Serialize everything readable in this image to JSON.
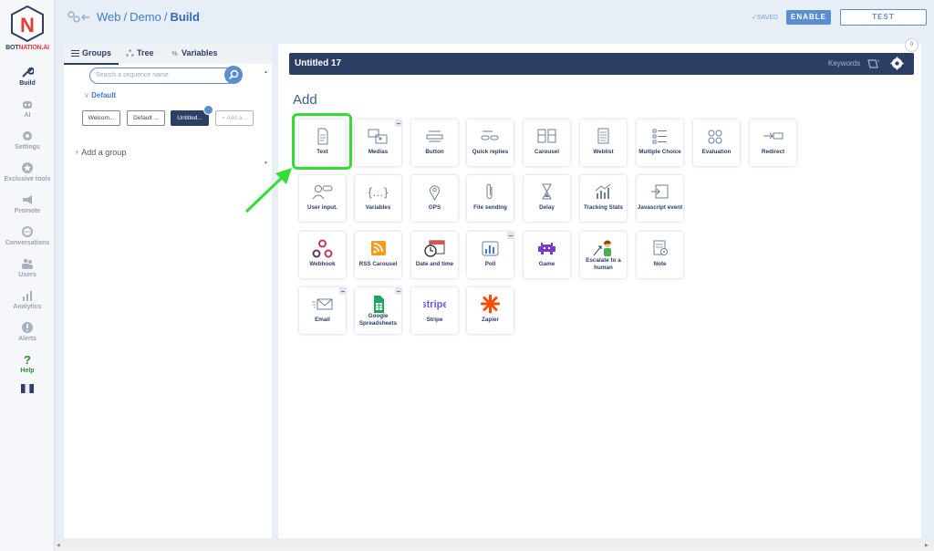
{
  "nav": {
    "logo_text_a": "BOT",
    "logo_text_b": "NATION.AI",
    "items": [
      {
        "label": "Build",
        "icon": "wrench-icon"
      },
      {
        "label": "AI",
        "icon": "robot-icon"
      },
      {
        "label": "Settings",
        "icon": "gear-icon"
      },
      {
        "label": "Exclusive tools",
        "icon": "star-badge-icon"
      },
      {
        "label": "Promote",
        "icon": "megaphone-icon"
      },
      {
        "label": "Conversations",
        "icon": "chat-icon"
      },
      {
        "label": "Users",
        "icon": "users-icon"
      },
      {
        "label": "Analytics",
        "icon": "analytics-icon"
      },
      {
        "label": "Alerts",
        "icon": "alert-icon"
      },
      {
        "label": "Help",
        "icon": "question-icon"
      }
    ]
  },
  "topbar": {
    "crumb1": "Web",
    "crumb2": "Demo",
    "crumb3": "Build",
    "saved": "SAVED",
    "enable": "ENABLE",
    "test": "TEST"
  },
  "groups_panel": {
    "tabs": [
      "Groups",
      "Tree",
      "Variables"
    ],
    "search_placeholder": "Search a sequence name",
    "group_name": "Default",
    "sequences": [
      "Welcom...",
      "Default ...",
      "Untitled...",
      "Add a..."
    ],
    "add_group": "Add a group"
  },
  "builder": {
    "title": "Untitled 17",
    "keywords": "Keywords",
    "badge_count": "0",
    "add_title": "Add",
    "tiles": [
      {
        "label": "Text"
      },
      {
        "label": "Medias"
      },
      {
        "label": "Button"
      },
      {
        "label": "Quick replies"
      },
      {
        "label": "Carousel"
      },
      {
        "label": "Weblist"
      },
      {
        "label": "Multiple Choice"
      },
      {
        "label": "Evaluation"
      },
      {
        "label": "Redirect"
      },
      {
        "label": "User input."
      },
      {
        "label": "Variables"
      },
      {
        "label": "GPS"
      },
      {
        "label": "File sending"
      },
      {
        "label": "Delay"
      },
      {
        "label": "Tracking Stats"
      },
      {
        "label": "Javascript event"
      },
      {
        "label": "Webhook"
      },
      {
        "label": "RSS Carousel"
      },
      {
        "label": "Date and time"
      },
      {
        "label": "Poll"
      },
      {
        "label": "Game"
      },
      {
        "label": "Escalate to a human"
      },
      {
        "label": "Note"
      },
      {
        "label": "Email"
      },
      {
        "label": "Google Spreadsheets"
      },
      {
        "label": "Stripe",
        "logo_text": "stripe"
      },
      {
        "label": "Zapier"
      }
    ]
  },
  "colors": {
    "primary": "#2c3e63",
    "accent": "#5b8dd1",
    "highlight": "#33dd33"
  }
}
